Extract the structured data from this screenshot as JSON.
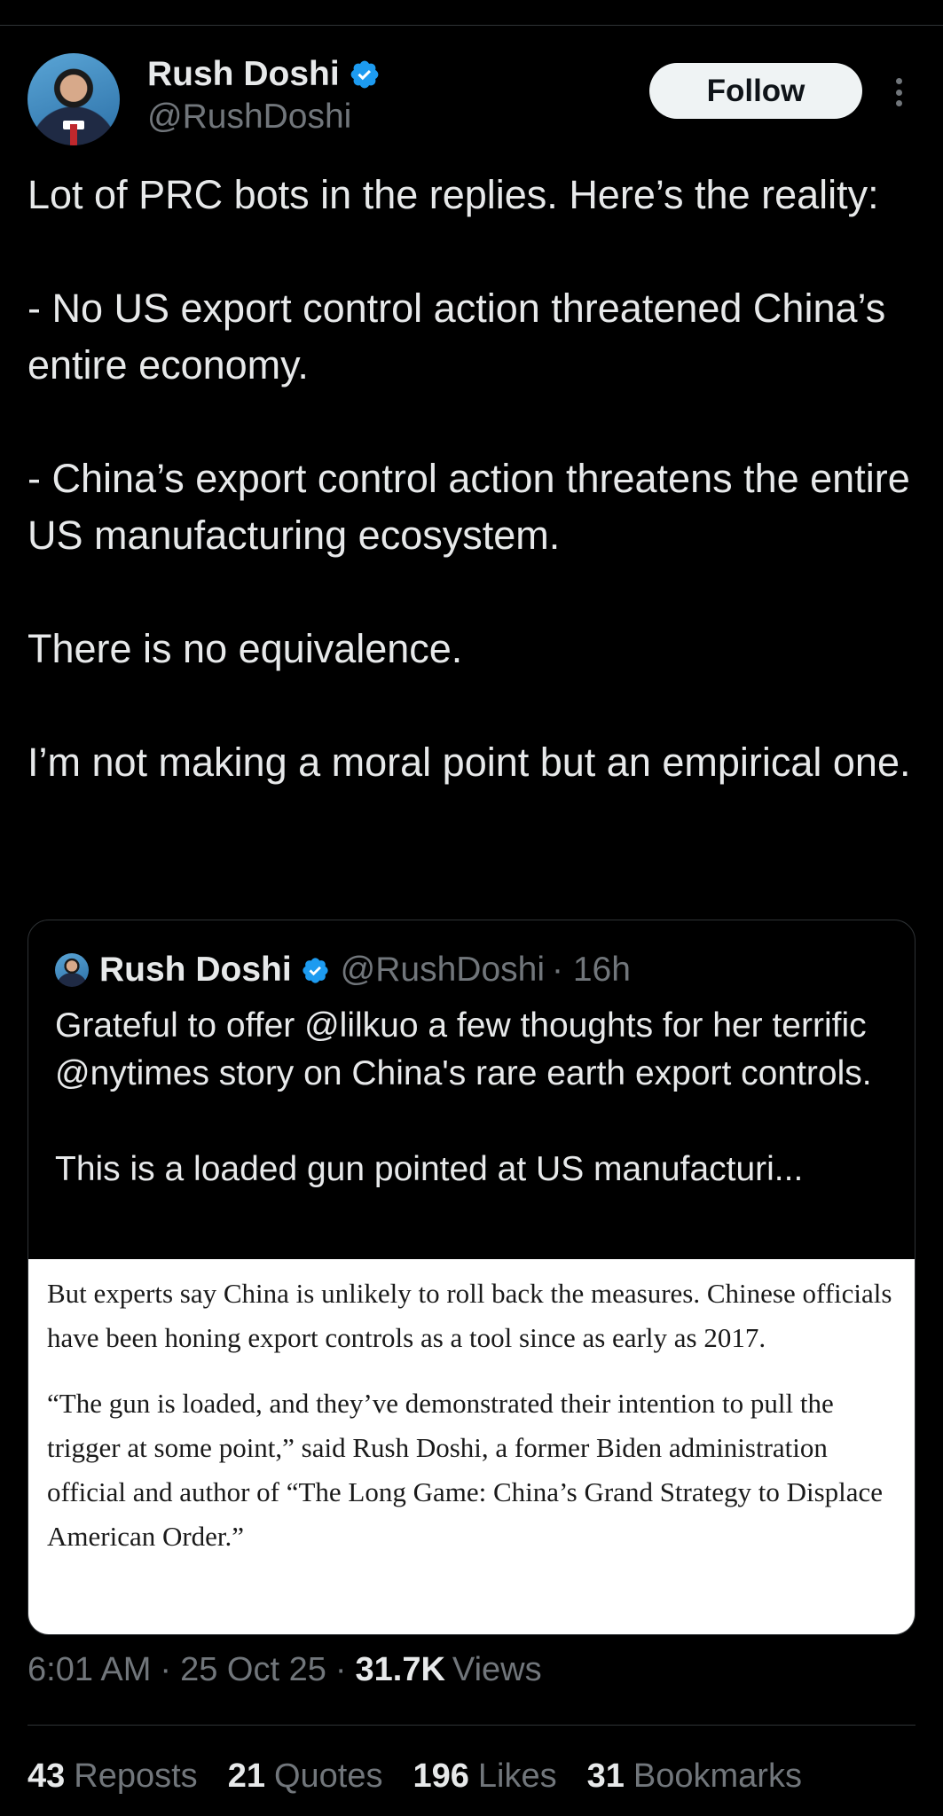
{
  "author": {
    "name": "Rush Doshi",
    "handle": "@RushDoshi",
    "follow_label": "Follow"
  },
  "tweet": {
    "paragraphs": [
      "Lot of PRC bots in the replies. Here’s the reality:",
      "- No US export control action threatened China’s entire economy.",
      "- China’s export control action threatens the entire US manufacturing ecosystem.",
      "There is no equivalence.",
      "I’m not making a moral point but an empirical one."
    ]
  },
  "quote": {
    "name": "Rush Doshi",
    "handle": "@RushDoshi",
    "time": "· 16h",
    "text_1": "Grateful to offer @lilkuo a few thoughts for her terrific @nytimes story on China's rare earth export controls.",
    "text_2": "This is a loaded gun pointed at US manufacturi...",
    "image_paragraph_1": "But experts say China is unlikely to roll back the measures. Chinese officials have been honing export controls as a tool since as early as 2017.",
    "image_paragraph_2": "“The gun is loaded, and they’ve demonstrated their intention to pull the trigger at some point,” said Rush Doshi, a former Biden administration official and author of “The Long Game: China’s Grand Strategy to Displace American Order.”"
  },
  "meta": {
    "time": "6:01 AM",
    "date": "25 Oct 25",
    "views_count": "31.7K",
    "views_label": "Views",
    "separator": "·"
  },
  "stats": {
    "reposts_count": "43",
    "reposts_label": "Reposts",
    "quotes_count": "21",
    "quotes_label": "Quotes",
    "likes_count": "196",
    "likes_label": "Likes",
    "bookmarks_count": "31",
    "bookmarks_label": "Bookmarks"
  },
  "colors": {
    "background": "#000000",
    "text": "#e7e9ea",
    "muted": "#71767b",
    "verified": "#1d9bf0",
    "divider": "#2f3336"
  }
}
